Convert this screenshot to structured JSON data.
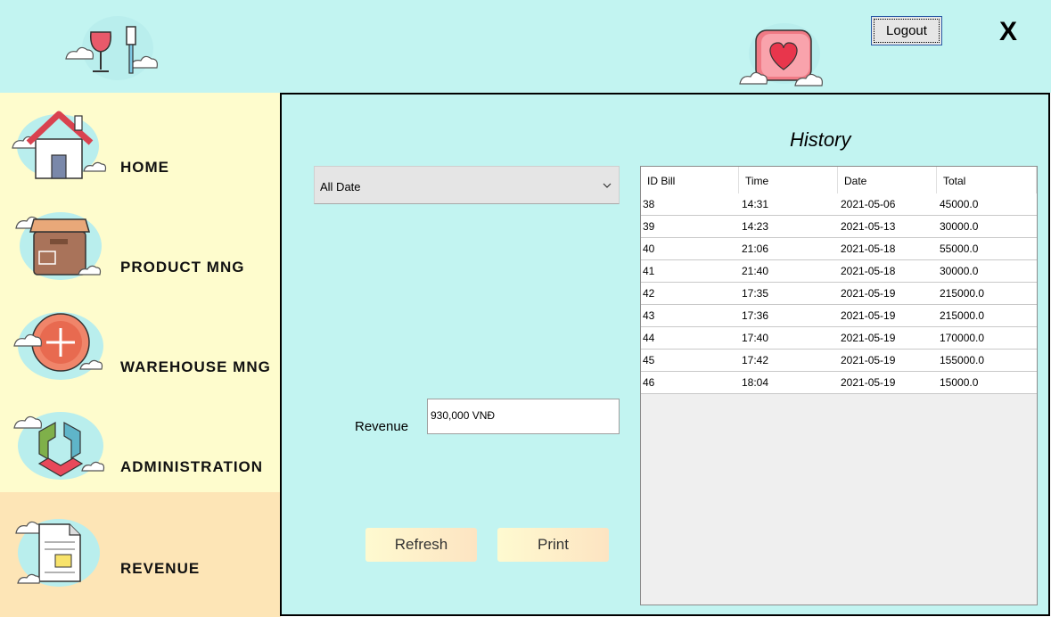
{
  "header": {
    "logout_label": "Logout",
    "close_label": "X"
  },
  "sidebar": {
    "items": [
      {
        "label": "HOME",
        "icon": "home-icon"
      },
      {
        "label": "PRODUCT MNG",
        "icon": "box-icon"
      },
      {
        "label": "WAREHOUSE MNG",
        "icon": "plus-circle-icon"
      },
      {
        "label": "ADMINISTRATION",
        "icon": "admin-hexagon-icon"
      },
      {
        "label": "REVENUE",
        "icon": "document-icon",
        "active": true
      }
    ]
  },
  "filter": {
    "selected": "All Date"
  },
  "revenue": {
    "label": "Revenue",
    "value": "930,000 VNĐ"
  },
  "buttons": {
    "refresh": "Refresh",
    "print": "Print"
  },
  "history": {
    "title": "History",
    "columns": [
      "ID Bill",
      "Time",
      "Date",
      "Total"
    ],
    "rows": [
      [
        "38",
        "14:31",
        "2021-05-06",
        "45000.0"
      ],
      [
        "39",
        "14:23",
        "2021-05-13",
        "30000.0"
      ],
      [
        "40",
        "21:06",
        "2021-05-18",
        "55000.0"
      ],
      [
        "41",
        "21:40",
        "2021-05-18",
        "30000.0"
      ],
      [
        "42",
        "17:35",
        "2021-05-19",
        "215000.0"
      ],
      [
        "43",
        "17:36",
        "2021-05-19",
        "215000.0"
      ],
      [
        "44",
        "17:40",
        "2021-05-19",
        "170000.0"
      ],
      [
        "45",
        "17:42",
        "2021-05-19",
        "155000.0"
      ],
      [
        "46",
        "18:04",
        "2021-05-19",
        "15000.0"
      ]
    ]
  },
  "colors": {
    "background": "#c2f4f1",
    "sidebar": "#fefccd",
    "sidebar_active": "#fde5b6"
  }
}
